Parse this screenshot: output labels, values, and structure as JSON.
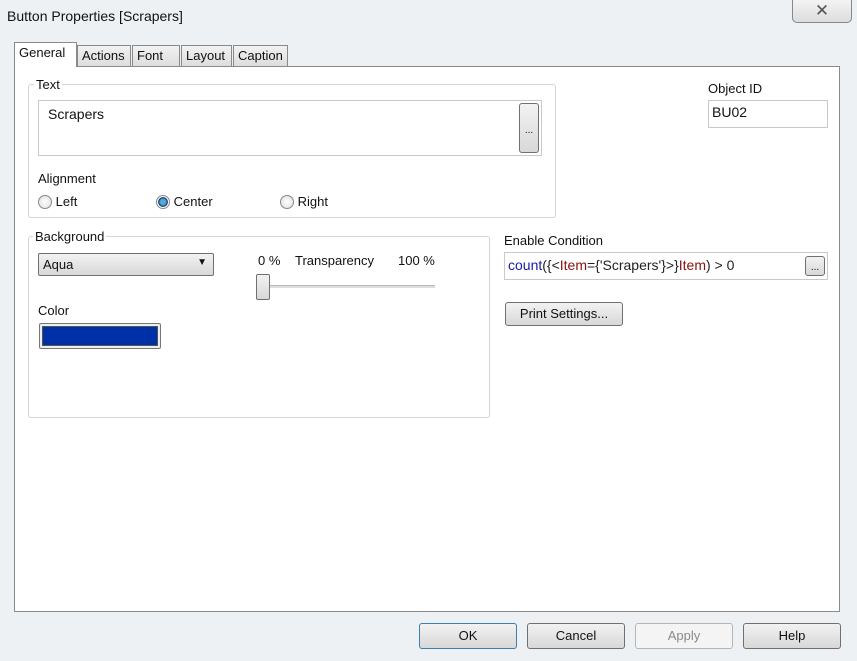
{
  "window": {
    "title": "Button Properties [Scrapers]",
    "close_icon": "close-icon"
  },
  "tabs": [
    {
      "label": "General",
      "active": true
    },
    {
      "label": "Actions"
    },
    {
      "label": "Font"
    },
    {
      "label": "Layout"
    },
    {
      "label": "Caption"
    }
  ],
  "text_group": {
    "label": "Text",
    "value": "Scrapers",
    "browse_label": "...",
    "alignment_label": "Alignment",
    "alignment_options": [
      "Left",
      "Center",
      "Right"
    ],
    "alignment_selected": "Center"
  },
  "object_id": {
    "label": "Object ID",
    "value": "BU02"
  },
  "background": {
    "label": "Background",
    "selected": "Aqua",
    "transparency_min": "0 %",
    "transparency_label": "Transparency",
    "transparency_max": "100 %",
    "transparency_percent": 0,
    "color_label": "Color",
    "color": "#0030a8"
  },
  "enable_condition": {
    "label": "Enable Condition",
    "parts": [
      "count",
      "({<",
      "Item",
      "={'Scrapers'}>}",
      "Item",
      ") > 0"
    ],
    "browse_label": "...",
    "colors": {
      "function": "#1a1aa6",
      "field": "#8b1010",
      "text": "#222222"
    }
  },
  "print_settings_label": "Print Settings...",
  "footer": {
    "ok": "OK",
    "cancel": "Cancel",
    "apply": "Apply",
    "help": "Help"
  }
}
